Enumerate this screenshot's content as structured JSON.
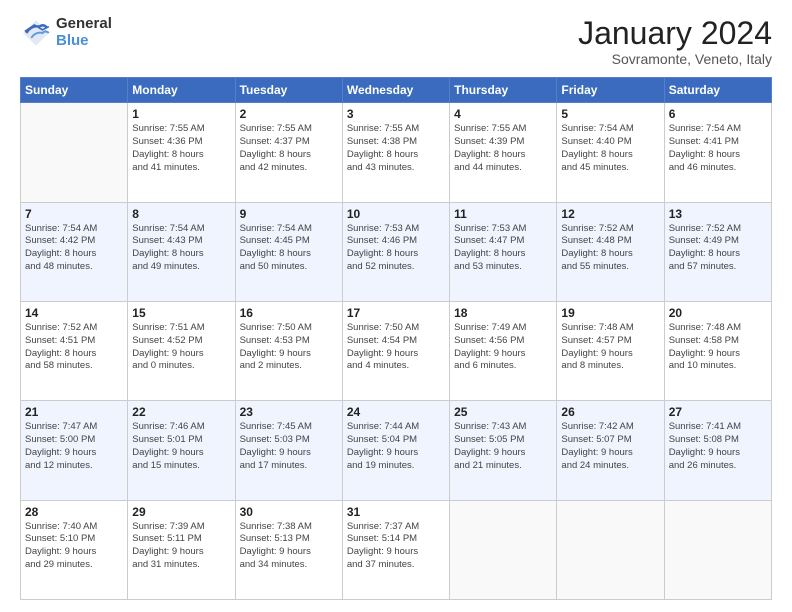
{
  "logo": {
    "general": "General",
    "blue": "Blue"
  },
  "header": {
    "month": "January 2024",
    "location": "Sovramonte, Veneto, Italy"
  },
  "days_of_week": [
    "Sunday",
    "Monday",
    "Tuesday",
    "Wednesday",
    "Thursday",
    "Friday",
    "Saturday"
  ],
  "weeks": [
    [
      {
        "day": "",
        "info": ""
      },
      {
        "day": "1",
        "info": "Sunrise: 7:55 AM\nSunset: 4:36 PM\nDaylight: 8 hours\nand 41 minutes."
      },
      {
        "day": "2",
        "info": "Sunrise: 7:55 AM\nSunset: 4:37 PM\nDaylight: 8 hours\nand 42 minutes."
      },
      {
        "day": "3",
        "info": "Sunrise: 7:55 AM\nSunset: 4:38 PM\nDaylight: 8 hours\nand 43 minutes."
      },
      {
        "day": "4",
        "info": "Sunrise: 7:55 AM\nSunset: 4:39 PM\nDaylight: 8 hours\nand 44 minutes."
      },
      {
        "day": "5",
        "info": "Sunrise: 7:54 AM\nSunset: 4:40 PM\nDaylight: 8 hours\nand 45 minutes."
      },
      {
        "day": "6",
        "info": "Sunrise: 7:54 AM\nSunset: 4:41 PM\nDaylight: 8 hours\nand 46 minutes."
      }
    ],
    [
      {
        "day": "7",
        "info": "Sunrise: 7:54 AM\nSunset: 4:42 PM\nDaylight: 8 hours\nand 48 minutes."
      },
      {
        "day": "8",
        "info": "Sunrise: 7:54 AM\nSunset: 4:43 PM\nDaylight: 8 hours\nand 49 minutes."
      },
      {
        "day": "9",
        "info": "Sunrise: 7:54 AM\nSunset: 4:45 PM\nDaylight: 8 hours\nand 50 minutes."
      },
      {
        "day": "10",
        "info": "Sunrise: 7:53 AM\nSunset: 4:46 PM\nDaylight: 8 hours\nand 52 minutes."
      },
      {
        "day": "11",
        "info": "Sunrise: 7:53 AM\nSunset: 4:47 PM\nDaylight: 8 hours\nand 53 minutes."
      },
      {
        "day": "12",
        "info": "Sunrise: 7:52 AM\nSunset: 4:48 PM\nDaylight: 8 hours\nand 55 minutes."
      },
      {
        "day": "13",
        "info": "Sunrise: 7:52 AM\nSunset: 4:49 PM\nDaylight: 8 hours\nand 57 minutes."
      }
    ],
    [
      {
        "day": "14",
        "info": "Sunrise: 7:52 AM\nSunset: 4:51 PM\nDaylight: 8 hours\nand 58 minutes."
      },
      {
        "day": "15",
        "info": "Sunrise: 7:51 AM\nSunset: 4:52 PM\nDaylight: 9 hours\nand 0 minutes."
      },
      {
        "day": "16",
        "info": "Sunrise: 7:50 AM\nSunset: 4:53 PM\nDaylight: 9 hours\nand 2 minutes."
      },
      {
        "day": "17",
        "info": "Sunrise: 7:50 AM\nSunset: 4:54 PM\nDaylight: 9 hours\nand 4 minutes."
      },
      {
        "day": "18",
        "info": "Sunrise: 7:49 AM\nSunset: 4:56 PM\nDaylight: 9 hours\nand 6 minutes."
      },
      {
        "day": "19",
        "info": "Sunrise: 7:48 AM\nSunset: 4:57 PM\nDaylight: 9 hours\nand 8 minutes."
      },
      {
        "day": "20",
        "info": "Sunrise: 7:48 AM\nSunset: 4:58 PM\nDaylight: 9 hours\nand 10 minutes."
      }
    ],
    [
      {
        "day": "21",
        "info": "Sunrise: 7:47 AM\nSunset: 5:00 PM\nDaylight: 9 hours\nand 12 minutes."
      },
      {
        "day": "22",
        "info": "Sunrise: 7:46 AM\nSunset: 5:01 PM\nDaylight: 9 hours\nand 15 minutes."
      },
      {
        "day": "23",
        "info": "Sunrise: 7:45 AM\nSunset: 5:03 PM\nDaylight: 9 hours\nand 17 minutes."
      },
      {
        "day": "24",
        "info": "Sunrise: 7:44 AM\nSunset: 5:04 PM\nDaylight: 9 hours\nand 19 minutes."
      },
      {
        "day": "25",
        "info": "Sunrise: 7:43 AM\nSunset: 5:05 PM\nDaylight: 9 hours\nand 21 minutes."
      },
      {
        "day": "26",
        "info": "Sunrise: 7:42 AM\nSunset: 5:07 PM\nDaylight: 9 hours\nand 24 minutes."
      },
      {
        "day": "27",
        "info": "Sunrise: 7:41 AM\nSunset: 5:08 PM\nDaylight: 9 hours\nand 26 minutes."
      }
    ],
    [
      {
        "day": "28",
        "info": "Sunrise: 7:40 AM\nSunset: 5:10 PM\nDaylight: 9 hours\nand 29 minutes."
      },
      {
        "day": "29",
        "info": "Sunrise: 7:39 AM\nSunset: 5:11 PM\nDaylight: 9 hours\nand 31 minutes."
      },
      {
        "day": "30",
        "info": "Sunrise: 7:38 AM\nSunset: 5:13 PM\nDaylight: 9 hours\nand 34 minutes."
      },
      {
        "day": "31",
        "info": "Sunrise: 7:37 AM\nSunset: 5:14 PM\nDaylight: 9 hours\nand 37 minutes."
      },
      {
        "day": "",
        "info": ""
      },
      {
        "day": "",
        "info": ""
      },
      {
        "day": "",
        "info": ""
      }
    ]
  ]
}
